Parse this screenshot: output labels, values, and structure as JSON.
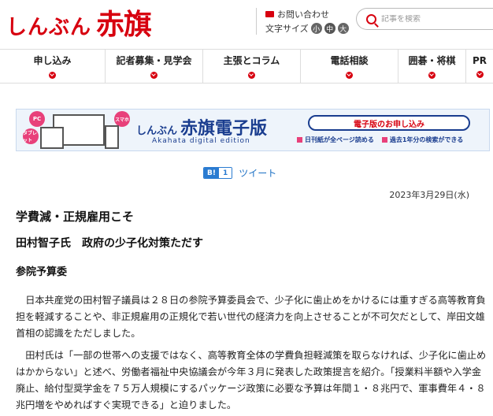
{
  "header": {
    "logo_small": "しんぶん",
    "logo_big": "赤旗",
    "contact_label": "お問い合わせ",
    "font_size_label": "文字サイズ",
    "font_sizes": [
      "小",
      "中",
      "大"
    ],
    "search_placeholder": "記事を検索"
  },
  "nav": {
    "items": [
      {
        "label": "申し込み"
      },
      {
        "label": "記者募集・見学会"
      },
      {
        "label": "主張とコラム"
      },
      {
        "label": "電話相談"
      },
      {
        "label": "囲碁・将棋"
      },
      {
        "label": "PR"
      }
    ]
  },
  "banner": {
    "badge_pc": "PC",
    "badge_tablet": "タブレット",
    "badge_phone": "スマホ",
    "title_small": "しんぶん",
    "title_big": "赤旗電子版",
    "subtitle": "Akahata digital edition",
    "apply_label": "電子版のお申し込み",
    "note1": "日刊紙が全ページ読める",
    "note2": "過去1年分の検索ができる"
  },
  "share": {
    "hatebu_b": "B!",
    "hatebu_count": "1",
    "tweet_label": "ツイート"
  },
  "article": {
    "date": "2023年3月29日(水)",
    "headline": "学費減・正規雇用こそ",
    "subheadline": "田村智子氏　政府の少子化対策ただす",
    "section": "参院予算委",
    "paragraph1": "日本共産党の田村智子議員は２８日の参院予算委員会で、少子化に歯止めをかけるには重すぎる高等教育負担を軽減することや、非正規雇用の正規化で若い世代の経済力を向上させることが不可欠だとして、岸田文雄首相の認識をただしました。",
    "paragraph2": "田村氏は「一部の世帯への支援ではなく、高等教育全体の学費負担軽減策を取らなければ、少子化に歯止めはかからない」と述べ、労働者福祉中央協議会が今年３月に発表した政策提言を紹介。「授業料半額や入学金廃止、給付型奨学金を７５万人規模にするパッケージ政策に必要な予算は年間１・８兆円で、軍事費年４・８兆円増をやめればすぐ実現できる」と迫りました。"
  }
}
